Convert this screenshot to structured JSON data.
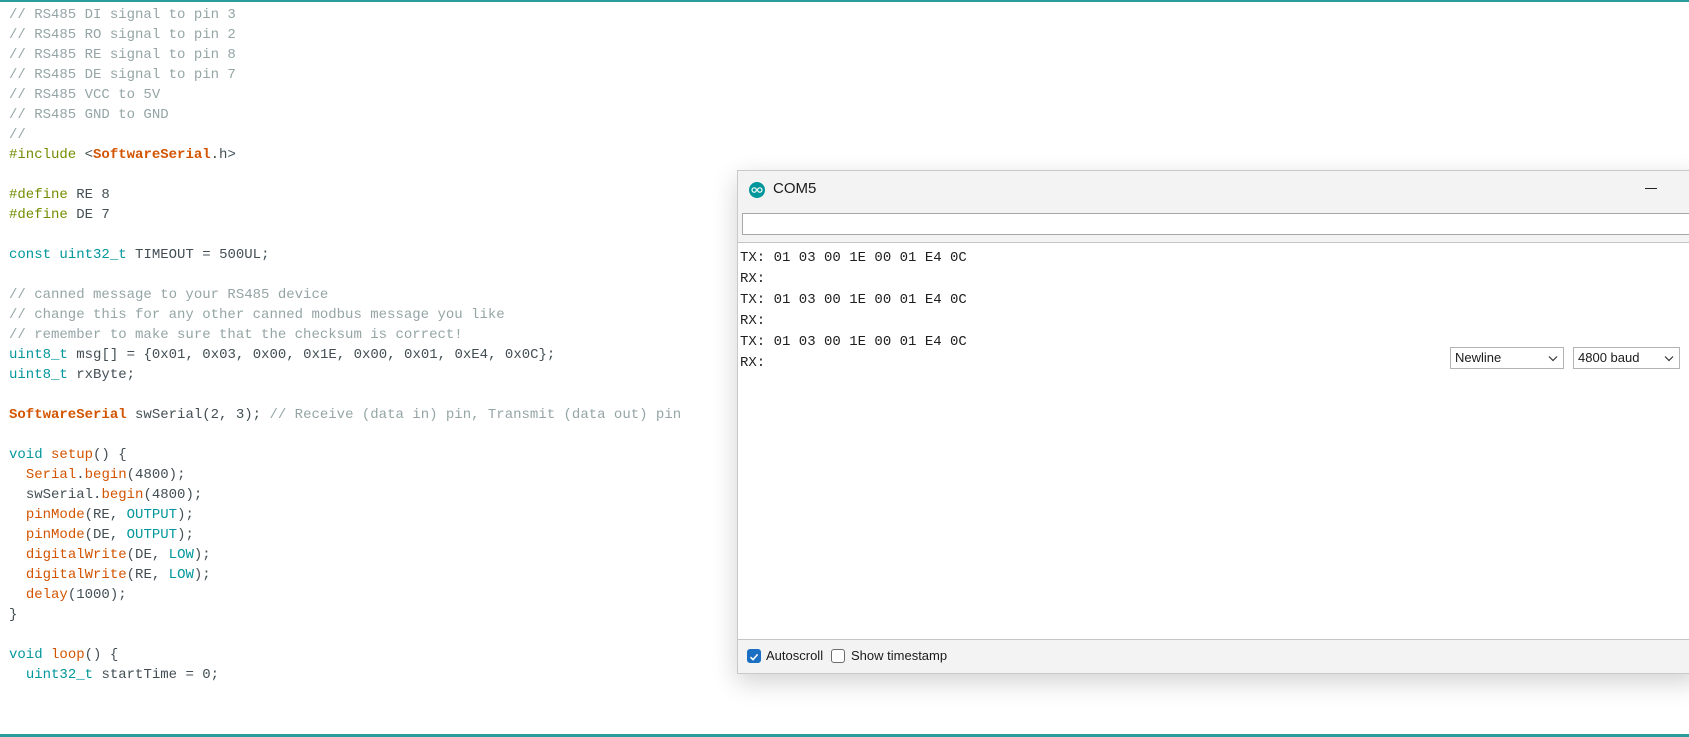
{
  "editor": {
    "lines": [
      "// RS485 DI signal to pin 3",
      "// RS485 RO signal to pin 2",
      "// RS485 RE signal to pin 8",
      "// RS485 DE signal to pin 7",
      "// RS485 VCC to 5V",
      "// RS485 GND to GND",
      "//",
      "#include <SoftwareSerial.h>",
      "",
      "#define RE 8",
      "#define DE 7",
      "",
      "const uint32_t TIMEOUT = 500UL;",
      "",
      "// canned message to your RS485 device",
      "// change this for any other canned modbus message you like",
      "// remember to make sure that the checksum is correct!",
      "uint8_t msg[] = {0x01, 0x03, 0x00, 0x1E, 0x00, 0x01, 0xE4, 0x0C};",
      "uint8_t rxByte;",
      "",
      "SoftwareSerial swSerial(2, 3); // Receive (data in) pin, Transmit (data out) pin",
      "",
      "void setup() {",
      "  Serial.begin(4800);",
      "  swSerial.begin(4800);",
      "  pinMode(RE, OUTPUT);",
      "  pinMode(DE, OUTPUT);",
      "  digitalWrite(DE, LOW);",
      "  digitalWrite(RE, LOW);",
      "  delay(1000);",
      "}",
      "",
      "void loop() {",
      "  uint32_t startTime = 0;"
    ]
  },
  "serial_monitor": {
    "title": "COM5",
    "logo_icon": "arduino-logo-icon",
    "send_input_value": "",
    "output_lines": [
      "TX: 01 03 00 1E 00 01 E4 0C",
      "RX:",
      "TX: 01 03 00 1E 00 01 E4 0C",
      "RX:",
      "TX: 01 03 00 1E 00 01 E4 0C",
      "RX:"
    ],
    "autoscroll_label": "Autoscroll",
    "autoscroll_checked": true,
    "timestamp_label": "Show timestamp",
    "timestamp_checked": false,
    "line_ending_selected": "Newline",
    "baud_selected": "4800 baud"
  },
  "colors": {
    "accent": "#2a9d9b",
    "comment": "#95a5a6",
    "type": "#00979c",
    "function": "#d35400",
    "directive": "#728e00"
  }
}
